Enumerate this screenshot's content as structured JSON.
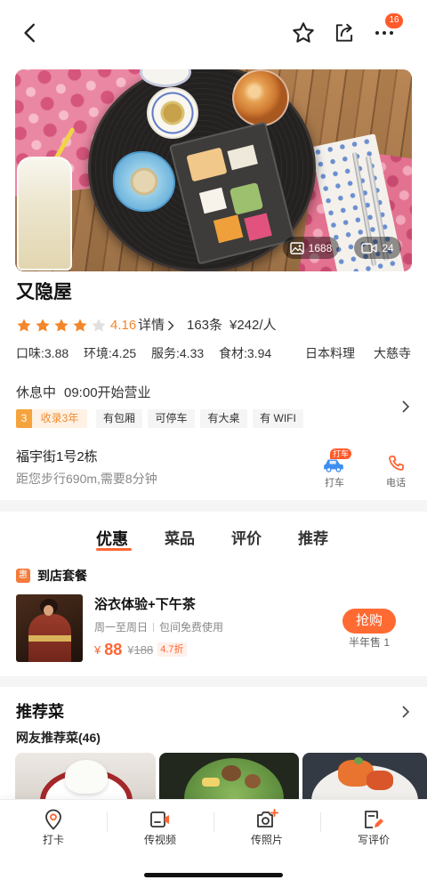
{
  "header": {
    "back_icon": "back-arrow-icon",
    "favorite_icon": "star-outline-icon",
    "share_icon": "share-icon",
    "more_icon": "more-dots-icon",
    "notification_badge": "16"
  },
  "hero": {
    "photo_icon": "image-icon",
    "photo_count": "1688",
    "video_icon": "video-camera-icon",
    "video_count": "24"
  },
  "shop": {
    "name": "又隐屋",
    "rating": {
      "stars_filled": 4,
      "stars_total": 5,
      "score": "4.16"
    },
    "details_link": "详情",
    "review_count": "163条",
    "price_per_person": "¥242/人",
    "scores": [
      "口味:3.88",
      "环境:4.25",
      "服务:4.33",
      "食材:3.94"
    ],
    "cuisine": "日本料理",
    "area": "大慈寺"
  },
  "hours": {
    "status": "休息中",
    "next_open": "09:00开始营业"
  },
  "tags": {
    "years_rank": "3",
    "years_label": "收录3年",
    "features": [
      "有包厢",
      "可停车",
      "有大桌",
      "有 WIFI"
    ]
  },
  "location": {
    "address": "福宇街1号2栋",
    "distance": "距您步行690m,需要8分钟",
    "taxi_badge": "打车",
    "taxi_label": "打车",
    "phone_label": "电话"
  },
  "tabs": [
    {
      "label": "优惠",
      "active": true
    },
    {
      "label": "菜品",
      "active": false
    },
    {
      "label": "评价",
      "active": false
    },
    {
      "label": "推荐",
      "active": false
    }
  ],
  "deals": {
    "section_badge": "惠",
    "section_title": "到店套餐",
    "items": [
      {
        "title": "浴衣体验+下午茶",
        "schedule": "周一至周日",
        "note": "包间免费使用",
        "currency": "¥",
        "price": "88",
        "original_currency": "¥",
        "original_price": "188",
        "discount": "4.7折",
        "buy_button": "抢购",
        "sales": "半年售 1"
      }
    ]
  },
  "recommended": {
    "title": "推荐菜",
    "subtitle": "网友推荐菜(46)"
  },
  "bottom_nav": [
    {
      "label": "打卡",
      "icon": "check-in-pin-icon"
    },
    {
      "label": "传视频",
      "icon": "upload-video-icon"
    },
    {
      "label": "传照片",
      "icon": "upload-photo-icon"
    },
    {
      "label": "写评价",
      "icon": "write-review-icon"
    }
  ],
  "colors": {
    "accent": "#ff6633",
    "rating": "#f5862b",
    "badge": "#ff5a2a",
    "text": "#222222",
    "muted": "#888888",
    "tag_bg": "#f5f5f5",
    "taxi": "#3d8ef0"
  }
}
